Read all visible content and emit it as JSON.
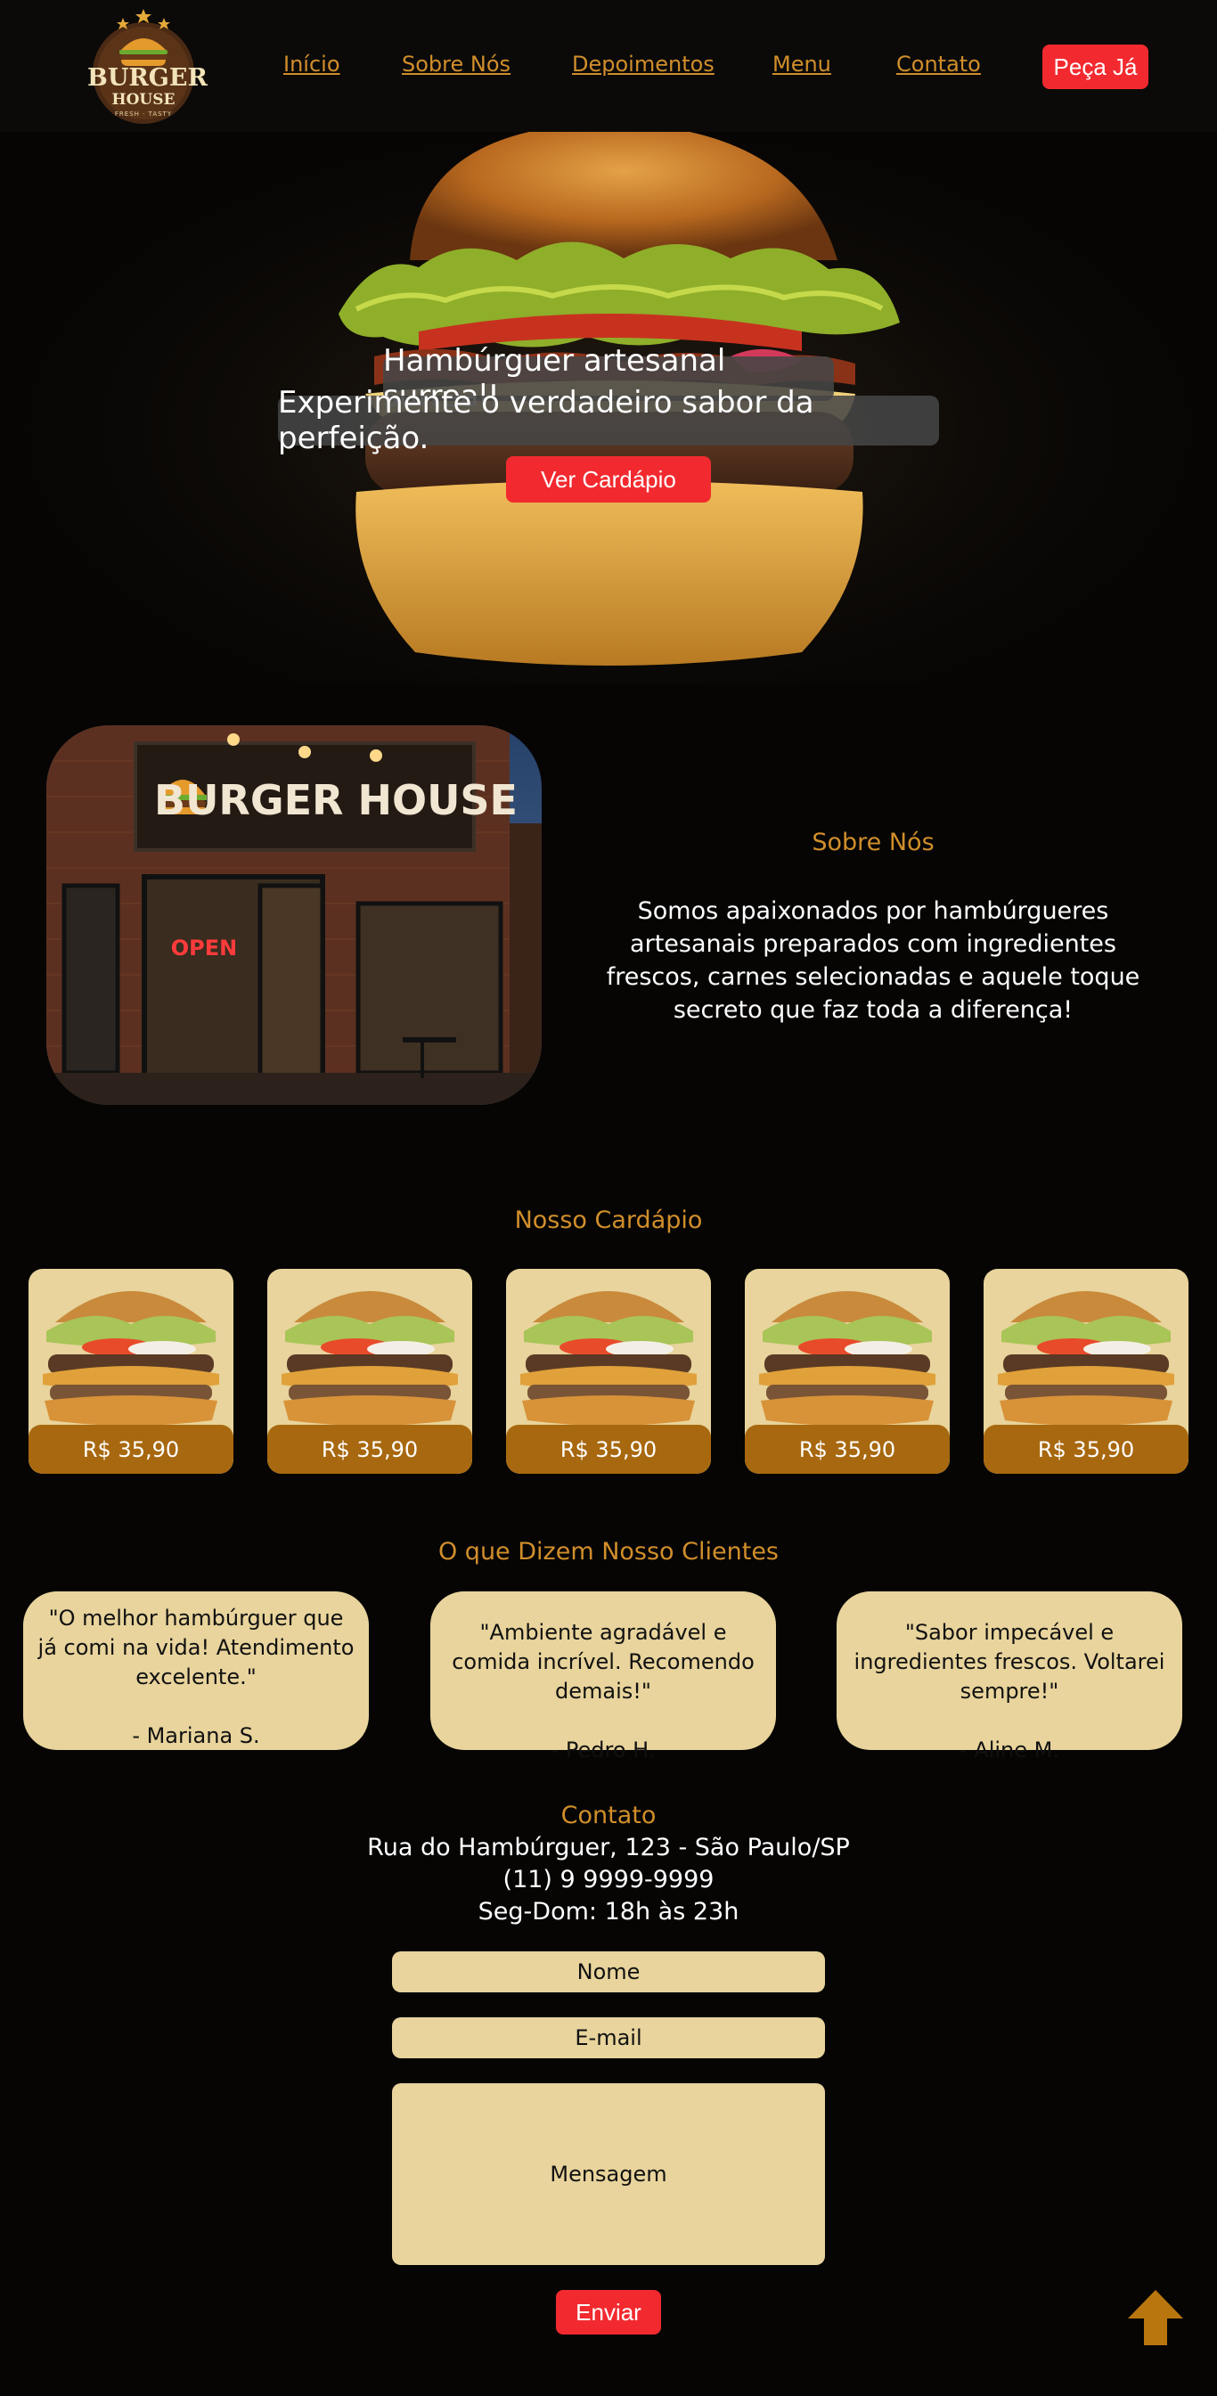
{
  "header": {
    "logo": {
      "line1": "BURGER",
      "line2": "HOUSE",
      "tagline": "FRESH · TASTY"
    },
    "nav": [
      "Início",
      "Sobre Nós",
      "Depoimentos",
      "Menu",
      "Contato"
    ],
    "order_button": "Peça Já"
  },
  "hero": {
    "headline": "Hambúrguer artesanal surreal!",
    "subheadline": "Experimente o verdadeiro sabor da perfeição.",
    "cta": "Ver Cardápio"
  },
  "about": {
    "store_sign": "BURGER HOUSE",
    "open_sign": "OPEN",
    "title": "Sobre Nós",
    "text": "Somos apaixonados por hambúrgueres artesanais preparados com ingredientes frescos, carnes selecionadas e aquele toque secreto que faz toda a diferença!"
  },
  "menu": {
    "title": "Nosso Cardápio",
    "items": [
      {
        "price": "R$ 35,90"
      },
      {
        "price": "R$ 35,90"
      },
      {
        "price": "R$ 35,90"
      },
      {
        "price": "R$ 35,90"
      },
      {
        "price": "R$ 35,90"
      }
    ]
  },
  "testimonials": {
    "title": "O que Dizem Nosso Clientes",
    "items": [
      {
        "quote": "\"O melhor hambúrguer que já comi na vida! Atendimento excelente.\"",
        "author": "- Mariana S."
      },
      {
        "quote": "\"Ambiente agradável e comida incrível. Recomendo demais!\"",
        "author": "- Pedro H."
      },
      {
        "quote": "\"Sabor impecável e ingredientes frescos. Voltarei sempre!\"",
        "author": "- Aline M."
      }
    ]
  },
  "contact": {
    "title": "Contato",
    "address": "Rua do Hambúrguer, 123 - São Paulo/SP",
    "phone": "(11) 9 9999-9999",
    "hours": "Seg-Dom: 18h às 23h",
    "form": {
      "name_placeholder": "Nome",
      "email_placeholder": "E-mail",
      "message_placeholder": "Mensagem",
      "submit": "Enviar"
    }
  },
  "icons": {
    "back_to_top": "arrow-up-icon",
    "logo": "burger-logo-icon"
  },
  "colors": {
    "background": "#060504",
    "accent_gold": "#d18e2b",
    "accent_red": "#f22a2f",
    "card_cream": "#e8d49c",
    "price_brown": "#a8680f"
  }
}
